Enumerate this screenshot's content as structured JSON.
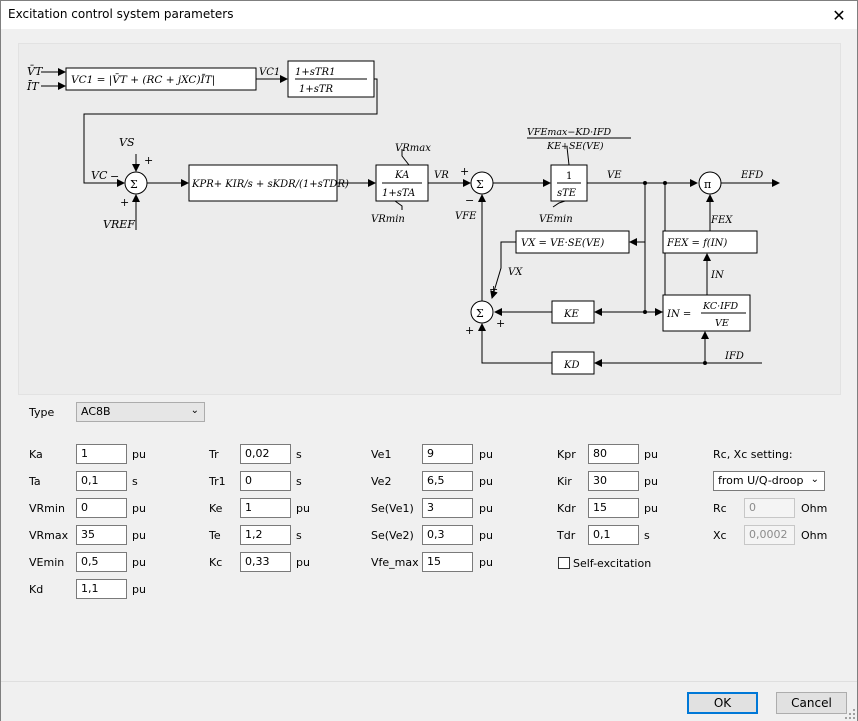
{
  "window": {
    "title": "Excitation control system parameters"
  },
  "type_row": {
    "label": "Type",
    "value": "AC8B"
  },
  "col1": [
    {
      "label": "Ka",
      "value": "1",
      "unit": "pu"
    },
    {
      "label": "Ta",
      "value": "0,1",
      "unit": "s"
    },
    {
      "label": "VRmin",
      "value": "0",
      "unit": "pu"
    },
    {
      "label": "VRmax",
      "value": "35",
      "unit": "pu"
    },
    {
      "label": "VEmin",
      "value": "0,5",
      "unit": "pu"
    },
    {
      "label": "Kd",
      "value": "1,1",
      "unit": "pu"
    }
  ],
  "col2": [
    {
      "label": "Tr",
      "value": "0,02",
      "unit": "s"
    },
    {
      "label": "Tr1",
      "value": "0",
      "unit": "s"
    },
    {
      "label": "Ke",
      "value": "1",
      "unit": "pu"
    },
    {
      "label": "Te",
      "value": "1,2",
      "unit": "s"
    },
    {
      "label": "Kc",
      "value": "0,33",
      "unit": "pu"
    }
  ],
  "col3": [
    {
      "label": "Ve1",
      "value": "9",
      "unit": "pu"
    },
    {
      "label": "Ve2",
      "value": "6,5",
      "unit": "pu"
    },
    {
      "label": "Se(Ve1)",
      "value": "3",
      "unit": "pu"
    },
    {
      "label": "Se(Ve2)",
      "value": "0,3",
      "unit": "pu"
    },
    {
      "label": "Vfe_max",
      "value": "15",
      "unit": "pu"
    }
  ],
  "col4": [
    {
      "label": "Kpr",
      "value": "80",
      "unit": "pu"
    },
    {
      "label": "Kir",
      "value": "30",
      "unit": "pu"
    },
    {
      "label": "Kdr",
      "value": "15",
      "unit": "pu"
    },
    {
      "label": "Tdr",
      "value": "0,1",
      "unit": "s"
    }
  ],
  "self_excitation": {
    "label": "Self-excitation",
    "checked": false
  },
  "rc_xc": {
    "heading": "Rc, Xc setting:",
    "mode": "from U/Q-droop",
    "rc": {
      "label": "Rc",
      "value": "0",
      "unit": "Ohm"
    },
    "xc": {
      "label": "Xc",
      "value": "0,0002",
      "unit": "Ohm"
    }
  },
  "buttons": {
    "ok": "OK",
    "cancel": "Cancel"
  },
  "diagram": {
    "vt": "V̄T",
    "it": "ĪT",
    "vc1_eq": "VC1 = |V̄T + (RC + jXC)ĪT|",
    "vc1": "VC1",
    "tr_num": "1+sTR1",
    "tr_den": "1+sTR",
    "vs": "VS",
    "vc": "VC",
    "vref": "VREF",
    "sigma": "Σ",
    "pi": "π",
    "pid": "KPR+ KIR/s + sKDR/(1+sTDR)",
    "vrmax": "VRmax",
    "vrmin": "VRmin",
    "ka_num": "KA",
    "ka_den": "1+sTA",
    "vr": "VR",
    "vfe": "VFE",
    "vfemax_num": "VFEmax−KD·IFD",
    "vfemax_den": "KE+SE(VE)",
    "int_num": "1",
    "int_den": "sTE",
    "ve": "VE",
    "vemin": "VEmin",
    "efd": "EFD",
    "vx_eq": "VX = VE·SE(VE)",
    "vx": "VX",
    "fex_eq": "FEX = f(IN)",
    "fex": "FEX",
    "in": "IN",
    "ke": "KE",
    "kd": "KD",
    "in_eq_lhs": "IN =",
    "in_num": "KC·IFD",
    "in_den": "VE",
    "ifd": "IFD",
    "plus": "+",
    "minus": "−"
  }
}
